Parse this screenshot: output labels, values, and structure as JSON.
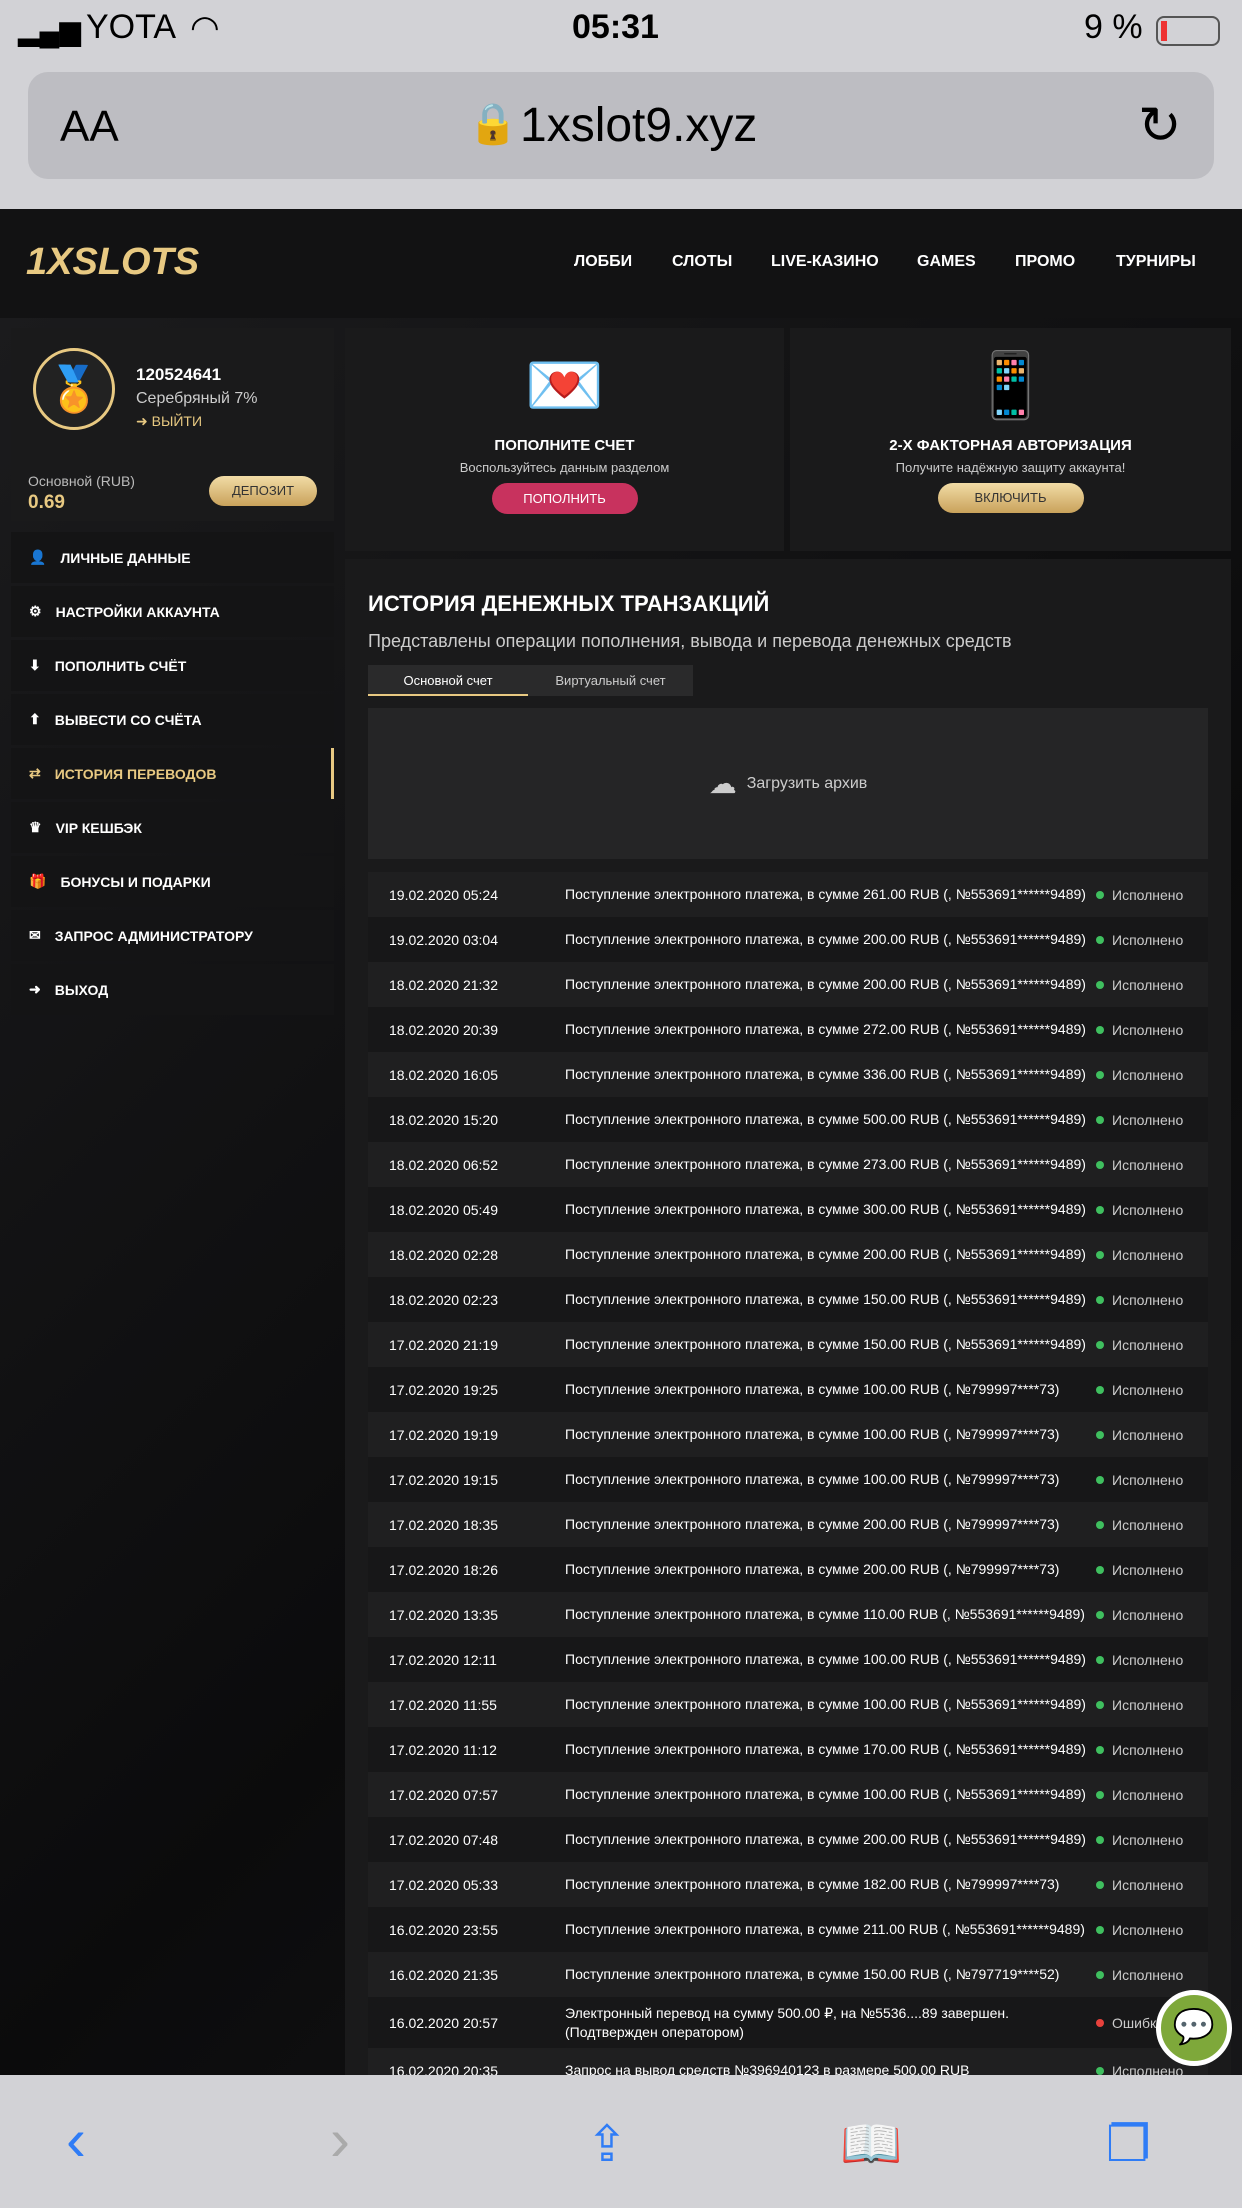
{
  "status_bar": {
    "carrier": "YOTA",
    "time": "05:31",
    "battery": "9 %"
  },
  "browser": {
    "text_size": "AA",
    "url": "1xslot9.xyz"
  },
  "site": {
    "logo": "1XSLOTS",
    "nav": [
      "ЛОББИ",
      "СЛОТЫ",
      "LIVE-КАЗИНО",
      "GAMES",
      "ПРОМО",
      "ТУРНИРЫ"
    ],
    "profile": {
      "id": "120524641",
      "level": "Серебряный 7%",
      "logout": "ВЫЙТИ",
      "balance_label": "Основной (RUB)",
      "balance": "0.69",
      "deposit": "ДЕПОЗИТ"
    },
    "menu": [
      {
        "label": "ЛИЧНЫЕ ДАННЫЕ",
        "icon": "user-plus"
      },
      {
        "label": "НАСТРОЙКИ АККАУНТА",
        "icon": "gears"
      },
      {
        "label": "ПОПОЛНИТЬ СЧЁТ",
        "icon": "download"
      },
      {
        "label": "ВЫВЕСТИ СО СЧЁТА",
        "icon": "upload"
      },
      {
        "label": "ИСТОРИЯ ПЕРЕВОДОВ",
        "icon": "exchange",
        "active": true
      },
      {
        "label": "VIP КЕШБЭК",
        "icon": "crown"
      },
      {
        "label": "БОНУСЫ И ПОДАРКИ",
        "icon": "gift"
      },
      {
        "label": "ЗАПРОС АДМИНИСТРАТОРУ",
        "icon": "envelope"
      },
      {
        "label": "ВЫХОД",
        "icon": "sign-out"
      }
    ],
    "promo1": {
      "title": "ПОПОЛНИТЕ СЧЕТ",
      "text": "Воспользуйтесь данным разделом",
      "button": "ПОПОЛНИТЬ"
    },
    "promo2": {
      "title": "2-Х ФАКТОРНАЯ АВТОРИЗАЦИЯ",
      "text": "Получите надёжную защиту аккаунта!",
      "button": "ВКЛЮЧИТЬ"
    },
    "history": {
      "title": "ИСТОРИЯ ДЕНЕЖНЫХ ТРАНЗАКЦИЙ",
      "subtitle": "Представлены операции пополнения, вывода и перевода денежных средств",
      "tabs": [
        "Основной счет",
        "Виртуальный счет"
      ],
      "archive": "Загрузить архив",
      "rows": [
        [
          "19.02.2020 05:24",
          "Поступление электронного платежа, в сумме 261.00 RUB (, №553691******9489)",
          "Исполнено"
        ],
        [
          "19.02.2020 03:04",
          "Поступление электронного платежа, в сумме 200.00 RUB (, №553691******9489)",
          "Исполнено"
        ],
        [
          "18.02.2020 21:32",
          "Поступление электронного платежа, в сумме 200.00 RUB (, №553691******9489)",
          "Исполнено"
        ],
        [
          "18.02.2020 20:39",
          "Поступление электронного платежа, в сумме 272.00 RUB (, №553691******9489)",
          "Исполнено"
        ],
        [
          "18.02.2020 16:05",
          "Поступление электронного платежа, в сумме 336.00 RUB (, №553691******9489)",
          "Исполнено"
        ],
        [
          "18.02.2020 15:20",
          "Поступление электронного платежа, в сумме 500.00 RUB (, №553691******9489)",
          "Исполнено"
        ],
        [
          "18.02.2020 06:52",
          "Поступление электронного платежа, в сумме 273.00 RUB (, №553691******9489)",
          "Исполнено"
        ],
        [
          "18.02.2020 05:49",
          "Поступление электронного платежа, в сумме 300.00 RUB (, №553691******9489)",
          "Исполнено"
        ],
        [
          "18.02.2020 02:28",
          "Поступление электронного платежа, в сумме 200.00 RUB (, №553691******9489)",
          "Исполнено"
        ],
        [
          "18.02.2020 02:23",
          "Поступление электронного платежа, в сумме 150.00 RUB (, №553691******9489)",
          "Исполнено"
        ],
        [
          "17.02.2020 21:19",
          "Поступление электронного платежа, в сумме 150.00 RUB (, №553691******9489)",
          "Исполнено"
        ],
        [
          "17.02.2020 19:25",
          "Поступление электронного платежа, в сумме 100.00 RUB (, №799997****73)",
          "Исполнено"
        ],
        [
          "17.02.2020 19:19",
          "Поступление электронного платежа, в сумме 100.00 RUB (, №799997****73)",
          "Исполнено"
        ],
        [
          "17.02.2020 19:15",
          "Поступление электронного платежа, в сумме 100.00 RUB (, №799997****73)",
          "Исполнено"
        ],
        [
          "17.02.2020 18:35",
          "Поступление электронного платежа, в сумме 200.00 RUB (, №799997****73)",
          "Исполнено"
        ],
        [
          "17.02.2020 18:26",
          "Поступление электронного платежа, в сумме 200.00 RUB (, №799997****73)",
          "Исполнено"
        ],
        [
          "17.02.2020 13:35",
          "Поступление электронного платежа, в сумме 110.00 RUB (, №553691******9489)",
          "Исполнено"
        ],
        [
          "17.02.2020 12:11",
          "Поступление электронного платежа, в сумме 100.00 RUB (, №553691******9489)",
          "Исполнено"
        ],
        [
          "17.02.2020 11:55",
          "Поступление электронного платежа, в сумме 100.00 RUB (, №553691******9489)",
          "Исполнено"
        ],
        [
          "17.02.2020 11:12",
          "Поступление электронного платежа, в сумме 170.00 RUB (, №553691******9489)",
          "Исполнено"
        ],
        [
          "17.02.2020 07:57",
          "Поступление электронного платежа, в сумме 100.00 RUB (, №553691******9489)",
          "Исполнено"
        ],
        [
          "17.02.2020 07:48",
          "Поступление электронного платежа, в сумме 200.00 RUB (, №553691******9489)",
          "Исполнено"
        ],
        [
          "17.02.2020 05:33",
          "Поступление электронного платежа, в сумме 182.00 RUB (, №799997****73)",
          "Исполнено"
        ],
        [
          "16.02.2020 23:55",
          "Поступление электронного платежа, в сумме 211.00 RUB (, №553691******9489)",
          "Исполнено"
        ],
        [
          "16.02.2020 21:35",
          "Поступление электронного платежа, в сумме 150.00 RUB (, №797719****52)",
          "Исполнено"
        ],
        [
          "16.02.2020 20:57",
          "Электронный перевод на сумму 500.00 ₽, на №5536....89 завершен. (Подтвержден оператором)",
          "Ошибка"
        ],
        [
          "16.02.2020 20:35",
          "Запрос на вывод средств №396940123 в размере 500.00 RUB",
          "Исполнено"
        ]
      ]
    },
    "colors": {
      "gold": "#e8c982",
      "success": "#3fbf5f",
      "error": "#e8413c",
      "pink": "#c8325e",
      "chat": "#7ea83a"
    }
  }
}
